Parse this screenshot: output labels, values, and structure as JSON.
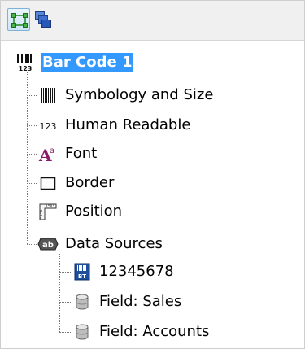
{
  "toolbar": {
    "buttons": [
      {
        "icon": "object-view-icon",
        "active": true
      },
      {
        "icon": "layers-view-icon",
        "active": false
      }
    ]
  },
  "tree": {
    "root": {
      "label": "Bar Code 1",
      "icon": "barcode-123-icon",
      "selected": true
    },
    "children": [
      {
        "label": "Symbology and Size",
        "icon": "barcode-icon"
      },
      {
        "label": "Human Readable",
        "icon": "digits-123-icon"
      },
      {
        "label": "Font",
        "icon": "font-icon"
      },
      {
        "label": "Border",
        "icon": "border-icon"
      },
      {
        "label": "Position",
        "icon": "ruler-position-icon"
      },
      {
        "label": "Data Sources",
        "icon": "data-source-icon",
        "children": [
          {
            "label": "12345678",
            "icon": "binary-data-icon"
          },
          {
            "label": "Field: Sales",
            "icon": "database-field-icon"
          },
          {
            "label": "Field: Accounts",
            "icon": "database-field-icon"
          }
        ]
      }
    ]
  }
}
